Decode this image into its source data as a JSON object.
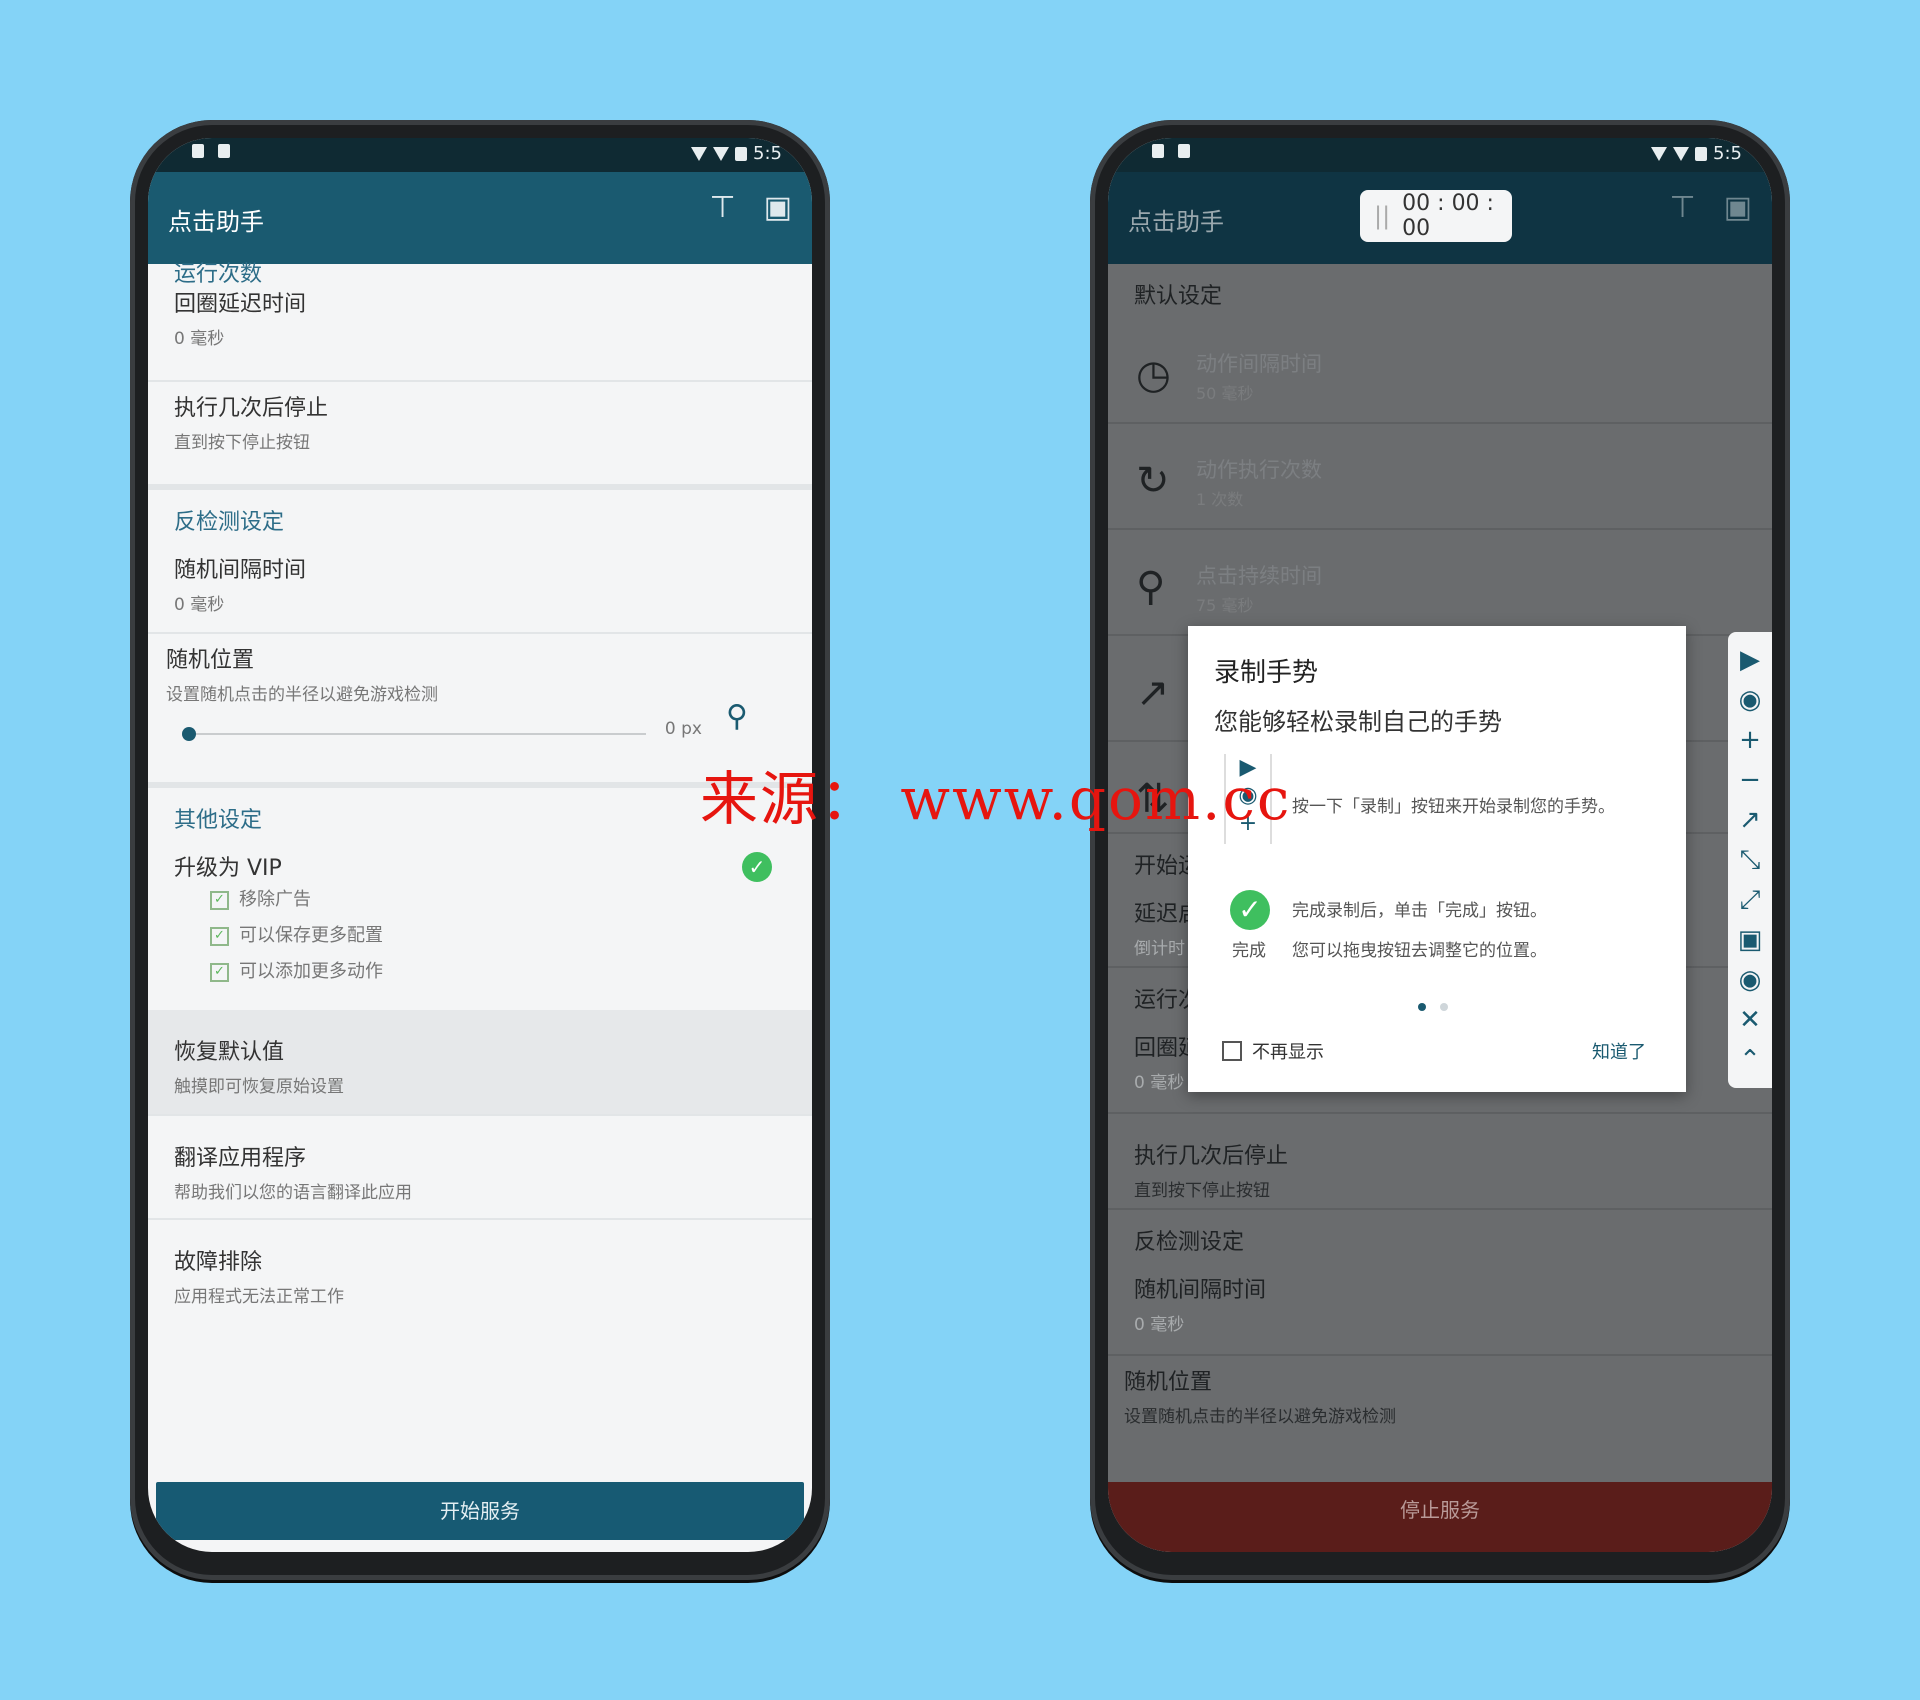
{
  "left": {
    "app_title": "点击助手",
    "statusbar_time": "5:5",
    "top_cut_section": "运行次数",
    "loop_delay": {
      "title": "回圈延迟时间",
      "value": "0 毫秒"
    },
    "stop_after": {
      "title": "执行几次后停止",
      "value": "直到按下停止按钮"
    },
    "anti_detect_header": "反检测设定",
    "random_interval": {
      "title": "随机间隔时间",
      "value": "0 毫秒"
    },
    "random_position": {
      "title": "随机位置",
      "desc": "设置随机点击的半径以避免游戏检测",
      "value": "0 px"
    },
    "other_header": "其他设定",
    "vip": {
      "title": "升级为 VIP",
      "features": [
        "移除广告",
        "可以保存更多配置",
        "可以添加更多动作"
      ]
    },
    "restore": {
      "title": "恢复默认值",
      "desc": "触摸即可恢复原始设置"
    },
    "translate": {
      "title": "翻译应用程序",
      "desc": "帮助我们以您的语言翻译此应用"
    },
    "troubleshoot": {
      "title": "故障排除",
      "desc": "应用程式无法正常工作"
    },
    "start_button": "开始服务"
  },
  "right": {
    "app_title": "点击助手",
    "statusbar_time": "5:5",
    "timer": "00 : 00 : 00",
    "default_header": "默认设定",
    "rows": [
      {
        "icon": "timer-icon",
        "title": "动作间隔时间",
        "value": "50 毫秒"
      },
      {
        "icon": "repeat-icon",
        "title": "动作执行次数",
        "value": "1 次数"
      },
      {
        "icon": "location-pin-icon",
        "title": "点击持续时间",
        "value": "75 毫秒"
      }
    ],
    "start_cut": "开始运",
    "delay_cut": "延迟启",
    "countdown_cut": "倒计时",
    "run_count_cut": "运行次",
    "loop_cut": "回圈延",
    "loop_value": "0 毫秒",
    "stop_after": {
      "title": "执行几次后停止",
      "value": "直到按下停止按钮"
    },
    "anti_detect_header": "反检测设定",
    "random_interval": {
      "title": "随机间隔时间",
      "value": "0 毫秒"
    },
    "random_position": {
      "title": "随机位置",
      "desc": "设置随机点击的半径以避免游戏检测"
    },
    "stop_button": "停止服务",
    "dialog": {
      "title": "录制手势",
      "subtitle": "您能够轻松录制自己的手势",
      "step1": "按一下「录制」按钮来开始录制您的手势。",
      "done_label": "完成",
      "step2a": "完成录制后，单击「完成」按钮。",
      "step2b": "您可以拖曳按钮去调整它的位置。",
      "no_more": "不再显示",
      "ok": "知道了"
    }
  },
  "watermark": "来源： www.qom.cc",
  "colors": {
    "background": "#84d3f7",
    "appbar": "#1a5a70",
    "accent_green": "#3fbf5f",
    "stop_red": "#5a1d1a",
    "watermark_red": "#e6150f"
  }
}
